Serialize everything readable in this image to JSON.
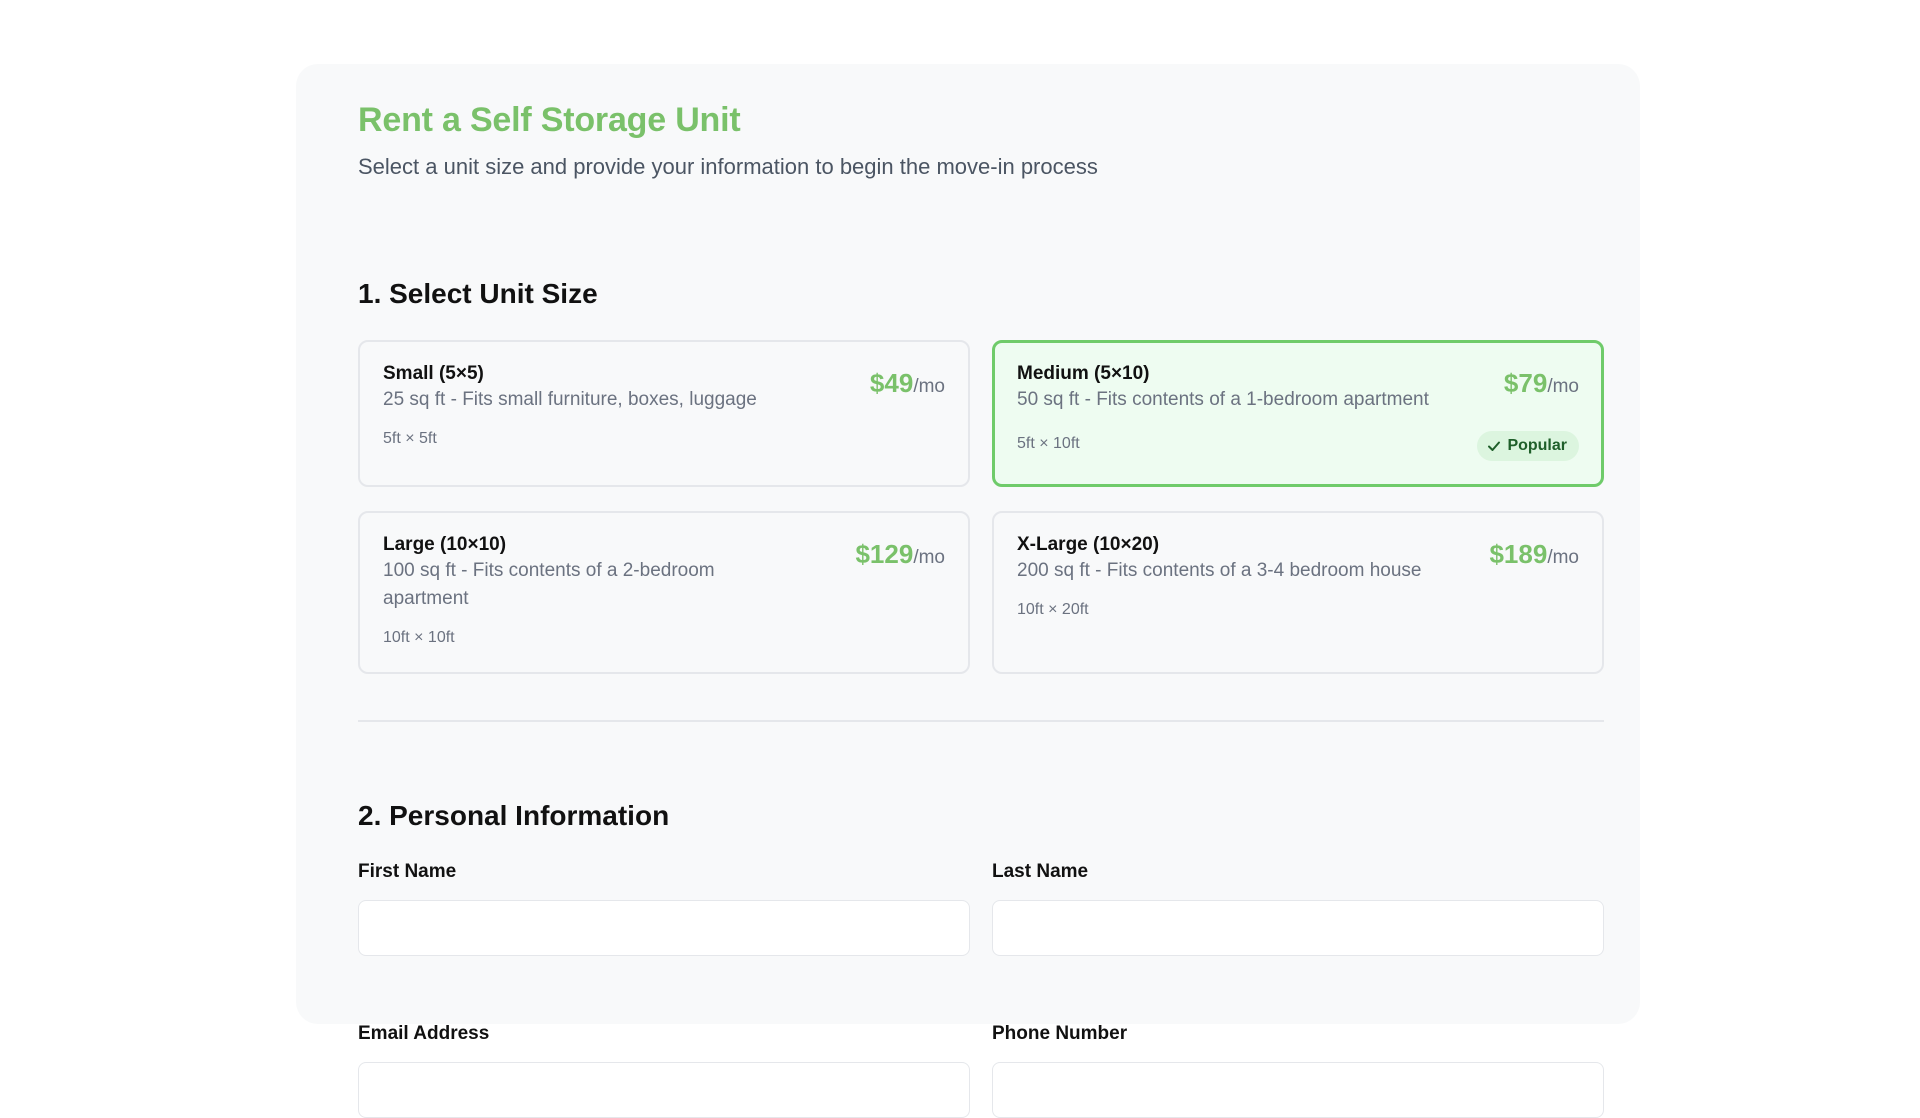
{
  "header": {
    "title": "Rent a Self Storage Unit",
    "subtitle": "Select a unit size and provide your information to begin the move-in process"
  },
  "colors": {
    "accent": "#7ac16a",
    "selected_border": "#6fcb6a",
    "selected_bg": "#eefcf1",
    "badge_bg": "#dcf5df",
    "badge_text": "#1f5f2a"
  },
  "unit_section": {
    "title": "1. Select Unit Size",
    "units": [
      {
        "name": "Small (5×5)",
        "description": "25 sq ft - Fits small furniture, boxes, luggage",
        "dimensions": "5ft × 5ft",
        "price": "$49",
        "per": "/mo",
        "selected": false,
        "badge": ""
      },
      {
        "name": "Medium (5×10)",
        "description": "50 sq ft - Fits contents of a 1-bedroom apartment",
        "dimensions": "5ft × 10ft",
        "price": "$79",
        "per": "/mo",
        "selected": true,
        "badge": "Popular",
        "badge_icon": "check-icon"
      },
      {
        "name": "Large (10×10)",
        "description": "100 sq ft - Fits contents of a 2-bedroom apartment",
        "dimensions": "10ft × 10ft",
        "price": "$129",
        "per": "/mo",
        "selected": false,
        "badge": ""
      },
      {
        "name": "X-Large (10×20)",
        "description": "200 sq ft - Fits contents of a 3-4 bedroom house",
        "dimensions": "10ft × 20ft",
        "price": "$189",
        "per": "/mo",
        "selected": false,
        "badge": ""
      }
    ]
  },
  "personal_section": {
    "title": "2. Personal Information",
    "fields": {
      "first_name": {
        "label": "First Name",
        "value": "",
        "placeholder": ""
      },
      "last_name": {
        "label": "Last Name",
        "value": "",
        "placeholder": ""
      },
      "email": {
        "label": "Email Address",
        "value": "",
        "placeholder": ""
      },
      "phone": {
        "label": "Phone Number",
        "value": "",
        "placeholder": ""
      }
    }
  }
}
